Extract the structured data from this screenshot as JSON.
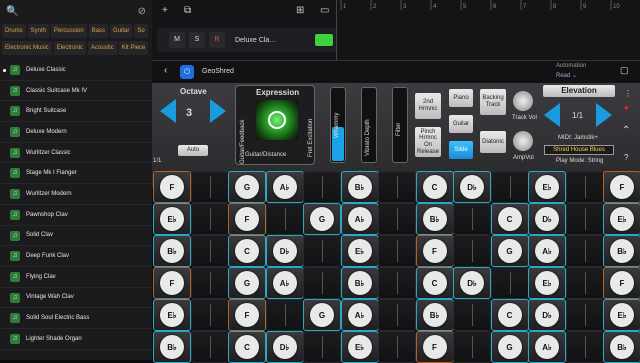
{
  "library": {
    "tags_row1": [
      "Drums",
      "Synth",
      "Percussion",
      "Bass",
      "Guitar",
      "So"
    ],
    "tags_row2": [
      "Electronic Music",
      "Electronic",
      "Acoustic",
      "Kit Piece"
    ],
    "patches": [
      "Deluxe Classic",
      "Classic Suitcase Mk IV",
      "Bright Suitcase",
      "Deluxe Modern",
      "Wurlitzer Classic",
      "Stage Mk I Flanger",
      "Wurlitzer Modern",
      "Pawnshop Clav",
      "Solid Clav",
      "Deep Funk Clav",
      "Flying Clav",
      "Vintage Wah Clav",
      "Solid Soul Electric Bass",
      "Lighter Shade Organ"
    ],
    "selected_index": 0
  },
  "track": {
    "m": "M",
    "s": "S",
    "r": "R",
    "name": "Deluxe Cla…"
  },
  "ruler_numbers": [
    "1",
    "2",
    "3",
    "4",
    "5",
    "6",
    "7",
    "8",
    "9",
    "10",
    "11"
  ],
  "plugin": {
    "title": "GeoShred",
    "automation_label": "Automation",
    "automation_value": "Read ⌄",
    "octave_label": "Octave",
    "octave_value": "3",
    "auto_label": "Auto",
    "expression_label": "Expression",
    "expr_left": "Guitar/Feedback",
    "expr_bottom": "Guitar/Distance",
    "fret_excitation": "Fret Excitation",
    "whammy": "Whammy",
    "vibrato": "Vibrato Depth",
    "filter": "Filter",
    "btn_2nd": "2nd Hrmnic",
    "btn_pinch": "Pinch Hrmnc On Release",
    "btn_piano": "Piano",
    "btn_guitar": "Guitar",
    "btn_slide": "Slide",
    "btn_backing": "Backing Track",
    "btn_diatonic": "Diatonic",
    "track_vol": "Track Vol",
    "amp_vol": "AmpVol",
    "elevation_label": "Elevation",
    "page": "1/1",
    "midi": "MIDI: Jamstik+",
    "preset": "Shred House Blues",
    "play_mode": "Play Mode: String",
    "page_small": "1/1"
  },
  "grid_rows": [
    [
      "F",
      "",
      "G",
      "A♭",
      "",
      "B♭",
      "",
      "C",
      "D♭",
      "",
      "E♭",
      "",
      "F"
    ],
    [
      "E♭",
      "",
      "F",
      "",
      "G",
      "A♭",
      "",
      "B♭",
      "",
      "C",
      "D♭",
      "",
      "E♭"
    ],
    [
      "B♭",
      "",
      "C",
      "D♭",
      "",
      "E♭",
      "",
      "F",
      "",
      "G",
      "A♭",
      "",
      "B♭"
    ],
    [
      "F",
      "",
      "G",
      "A♭",
      "",
      "B♭",
      "",
      "C",
      "D♭",
      "",
      "E♭",
      "",
      "F"
    ],
    [
      "E♭",
      "",
      "F",
      "",
      "G",
      "A♭",
      "",
      "B♭",
      "",
      "C",
      "D♭",
      "",
      "E♭"
    ],
    [
      "B♭",
      "",
      "C",
      "D♭",
      "",
      "E♭",
      "",
      "F",
      "",
      "G",
      "A♭",
      "",
      "B♭"
    ]
  ],
  "colors": {
    "accent": "#1aa3e8",
    "root": "#b35f25",
    "scale": "#2aa9c4",
    "green": "#3bd23b"
  }
}
